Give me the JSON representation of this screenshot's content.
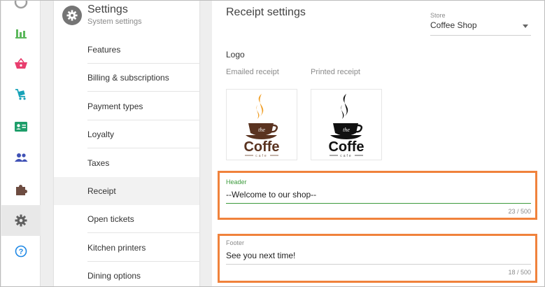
{
  "rail": {
    "items": [
      {
        "icon": "circle-icon"
      },
      {
        "icon": "bar-chart-icon"
      },
      {
        "icon": "basket-icon"
      },
      {
        "icon": "cart-icon"
      },
      {
        "icon": "id-card-icon"
      },
      {
        "icon": "people-icon"
      },
      {
        "icon": "puzzle-icon"
      },
      {
        "icon": "gear-icon"
      },
      {
        "icon": "help-icon"
      }
    ],
    "colors": {
      "green": "#5cb85c",
      "pink": "#e83e6e",
      "teal": "#17a2b8",
      "blue": "#3f51b5",
      "brown": "#6d4c41",
      "gray": "#616161",
      "help": "#1e88e5"
    }
  },
  "submenu": {
    "title": "Settings",
    "subtitle": "System settings",
    "items": [
      {
        "label": "Features"
      },
      {
        "label": "Billing & subscriptions"
      },
      {
        "label": "Payment types"
      },
      {
        "label": "Loyalty"
      },
      {
        "label": "Taxes"
      },
      {
        "label": "Receipt"
      },
      {
        "label": "Open tickets"
      },
      {
        "label": "Kitchen printers"
      },
      {
        "label": "Dining options"
      }
    ],
    "active_item": "Receipt"
  },
  "main": {
    "title": "Receipt settings",
    "store": {
      "label": "Store",
      "value": "Coffee Shop"
    },
    "logo_label": "Logo",
    "emailed_label": "Emailed receipt",
    "printed_label": "Printed receipt",
    "emailed_logo": {
      "word": "Coffe",
      "small": "the",
      "tag": "cafe"
    },
    "printed_logo": {
      "word": "Coffe",
      "small": "the",
      "tag": "cafe"
    },
    "header": {
      "label": "Header",
      "value": "--Welcome to our shop--",
      "count": "23 / 500"
    },
    "footer": {
      "label": "Footer",
      "value": "See you next time!",
      "count": "18 / 500"
    }
  },
  "colors": {
    "highlight": "#f0823c",
    "active_field": "#3c9a3c",
    "coffee_brown": "#5a3320",
    "coffee_orange": "#f0a02a"
  }
}
